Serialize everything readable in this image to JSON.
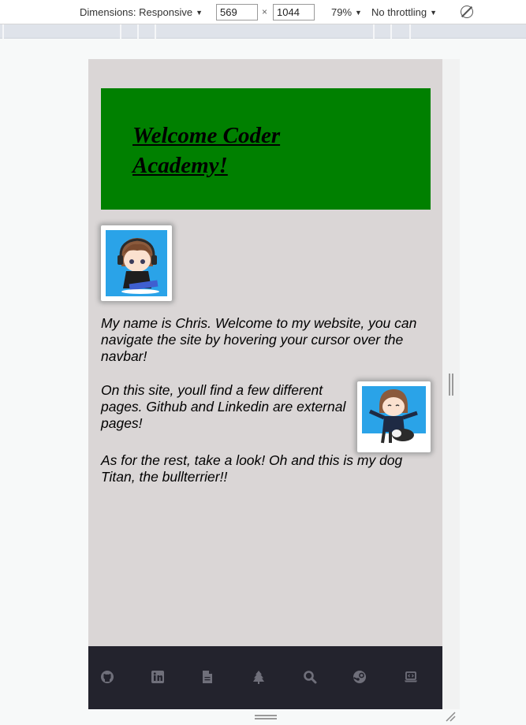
{
  "devtools": {
    "dimensions_label": "Dimensions: Responsive",
    "width_value": "569",
    "times_symbol": "×",
    "height_value": "1044",
    "zoom_label": "79%",
    "throttling_label": "No throttling",
    "rotate_icon": "rotate-icon"
  },
  "page": {
    "header_title": "Welcome Coder Academy!",
    "header_color": "#008000",
    "background_color": "#dad6d6",
    "paragraph_1": "My name is Chris. Welcome to my website, you can navigate the site by hovering your cursor over the navbar!",
    "paragraph_2": "On this site, youll find a few different pages. Github and Linkedin are external pages!",
    "paragraph_3": "As for the rest, take a look! Oh and this is my dog Titan, the bullterrier!!"
  },
  "navbar": {
    "color": "#23232d",
    "icons": [
      "github-icon",
      "linkedin-icon",
      "file-icon",
      "tree-icon",
      "search-icon",
      "steam-icon",
      "laptop-code-icon"
    ]
  }
}
